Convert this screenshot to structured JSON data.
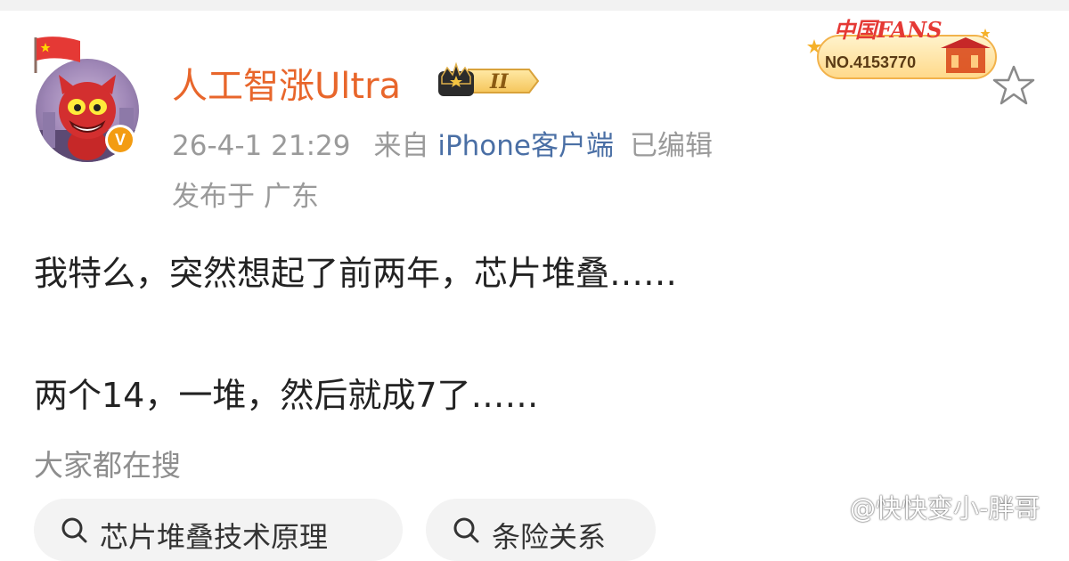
{
  "post": {
    "username": "人工智涨Ultra",
    "member_level": "II",
    "time": "26-4-1 21:29",
    "source_prefix": "来自",
    "source_client": "iPhone客户端",
    "edited": "已编辑",
    "location": "发布于 广东",
    "fans_badge_title": "中国FANS",
    "fans_badge_no": "NO.4153770",
    "verified_mark": "V",
    "content_line1": "我特么，突然想起了前两年，芯片堆叠……",
    "content_line2": "两个14，一堆，然后就成7了……"
  },
  "hot_search": {
    "title": "大家都在搜",
    "items": [
      {
        "label": "芯片堆叠技术原理"
      },
      {
        "label": "条险关系"
      }
    ]
  },
  "watermark": "@快快变小-胖哥",
  "colors": {
    "username": "#e8662b",
    "meta": "#9a9a9a",
    "link": "#4a6fa5",
    "verified": "#f39c12"
  },
  "icons": [
    "china-flag-icon",
    "crown-badge-icon",
    "star-icon",
    "search-icon",
    "weibo-logo-icon"
  ]
}
